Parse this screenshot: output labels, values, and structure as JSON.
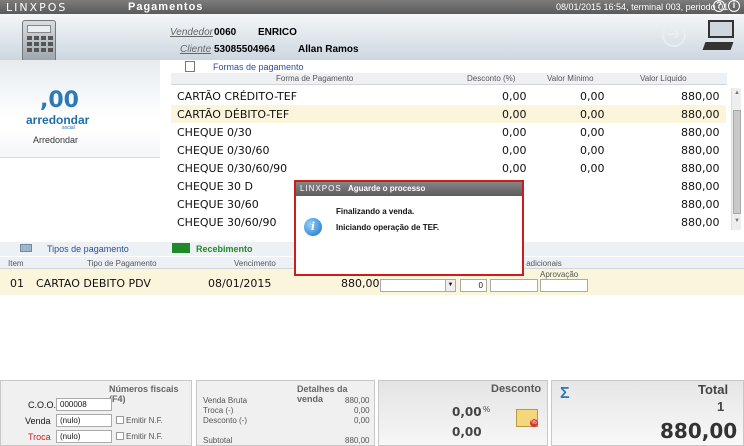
{
  "titlebar": {
    "logo": "LINXPOS",
    "title": "Pagamentos",
    "info": "08/01/2015 16:54, terminal 003, periodo 01.",
    "help_icon": "?",
    "info_icon": "i"
  },
  "header": {
    "vendedor_label": "Vendedor",
    "vendedor_code": "0060",
    "vendedor_name": "ENRICO",
    "cliente_label": "Cliente",
    "cliente_code": "53085504964",
    "cliente_name": "Allan Ramos"
  },
  "left": {
    "logo_top": ",00",
    "logo_word": "arredondar",
    "logo_sub": "social",
    "round_label": "Arredondar"
  },
  "forms": {
    "tab": "Formas de pagamento",
    "columns": [
      "Forma de Pagamento",
      "Desconto (%)",
      "Valor Mínimo",
      "Valor Líquido"
    ],
    "rows": [
      {
        "name": "CARTÃO CRÉDITO-TEF",
        "desc": "0,00",
        "min": "0,00",
        "liq": "880,00"
      },
      {
        "name": "CARTÃO DÉBITO-TEF",
        "desc": "0,00",
        "min": "0,00",
        "liq": "880,00"
      },
      {
        "name": "CHEQUE 0/30",
        "desc": "0,00",
        "min": "0,00",
        "liq": "880,00"
      },
      {
        "name": "CHEQUE 0/30/60",
        "desc": "0,00",
        "min": "0,00",
        "liq": "880,00"
      },
      {
        "name": "CHEQUE 0/30/60/90",
        "desc": "0,00",
        "min": "0,00",
        "liq": "880,00"
      },
      {
        "name": "CHEQUE 30 D",
        "desc": "",
        "min": "",
        "liq": "880,00"
      },
      {
        "name": "CHEQUE 30/60",
        "desc": "",
        "min": "",
        "liq": "880,00"
      },
      {
        "name": "CHEQUE 30/60/90",
        "desc": "",
        "min": "",
        "liq": "880,00"
      }
    ]
  },
  "tipos": {
    "tab_tipos": "Tipos de pagamento",
    "tab_recebimento": "Recebimento",
    "col_item": "Item",
    "col_tipo": "Tipo de Pagamento",
    "col_venc": "Vencimento",
    "col_add": "s adicionais",
    "col_aprov": "Aprovação",
    "row": {
      "item": "01",
      "tipo": "CARTAO DEBITO PDV",
      "venc": "08/01/2015",
      "valor": "880,00",
      "parcelas": "0"
    }
  },
  "modal": {
    "logo": "LINXPOS",
    "title": "Aguarde o processo",
    "line1": "Finalizando a venda.",
    "line2": "Iniciando operação de TEF."
  },
  "fiscal": {
    "title": "Números fiscais (F4)",
    "coo_label": "C.O.O.",
    "coo_value": "000008",
    "venda_label": "Venda",
    "venda_value": "(nulo)",
    "troca_label": "Troca",
    "troca_value": "(nulo)",
    "emitir1": "Emitir N.F.",
    "emitir2": "Emitir N.F."
  },
  "detalhes": {
    "title": "Detalhes da venda",
    "venda_bruta_label": "Venda Bruta",
    "venda_bruta": "880,00",
    "troca_label": "Troca (-)",
    "troca": "0,00",
    "desconto_label": "Desconto (-)",
    "desconto": "0,00",
    "subtotal_label": "Subtotal",
    "subtotal": "880,00"
  },
  "desconto": {
    "title": "Desconto",
    "pct": "0,00",
    "pct_sign": "%",
    "valor": "0,00"
  },
  "total": {
    "title": "Total",
    "qty": "1",
    "value": "880,00"
  },
  "colors": {
    "accent_blue": "#2a4f9a",
    "modal_border": "#cc1c1c",
    "selected_row": "#fbf5dc",
    "recebimento_green": "#1e8a2a"
  }
}
